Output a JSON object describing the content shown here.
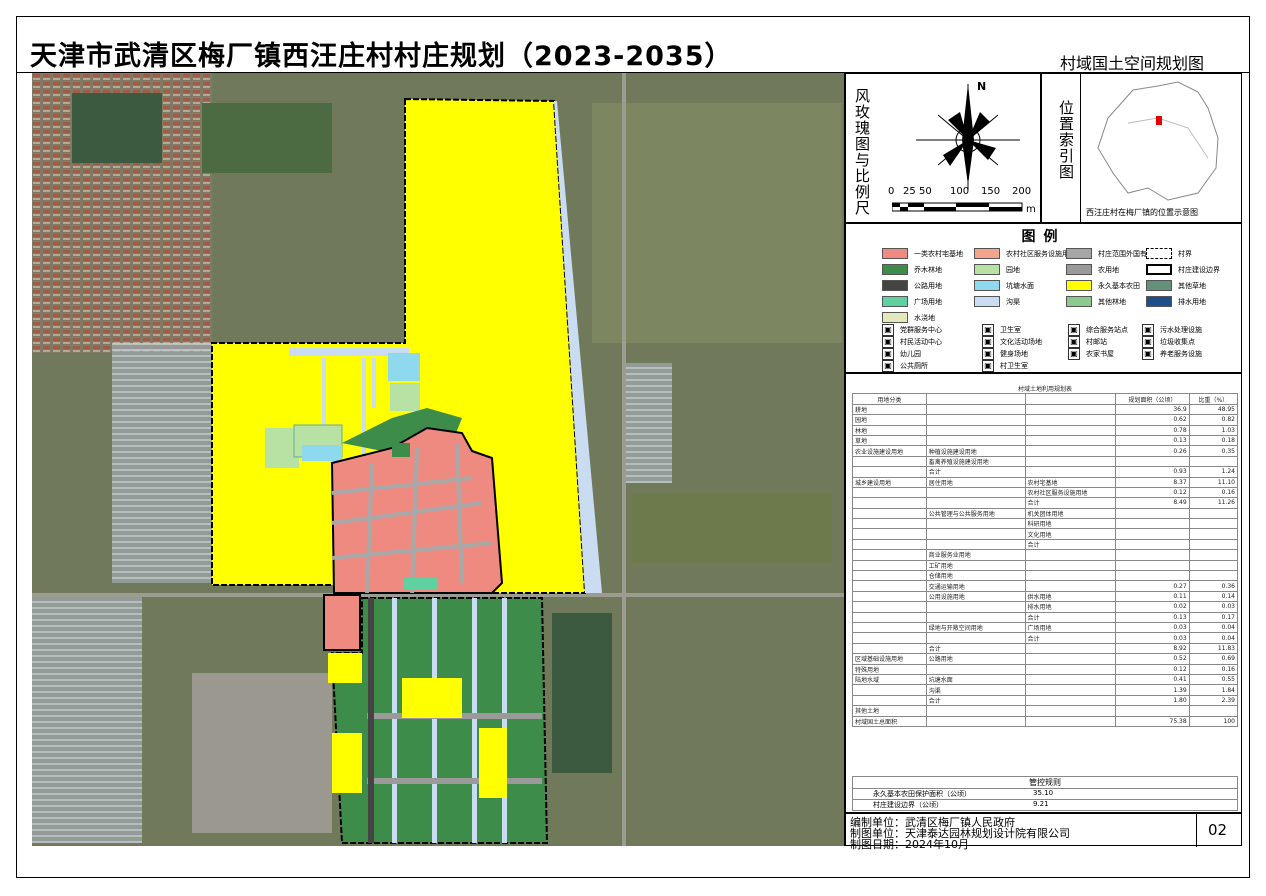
{
  "title": "天津市武清区梅厂镇西汪庄村村庄规划（2023-2035）",
  "subtitle": "村域国土空间规划图",
  "compass": {
    "north_label": "N",
    "vertical_label": "风玫瑰图与比例尺",
    "scale_ticks": [
      "0",
      "25",
      "50",
      "100",
      "150",
      "200"
    ],
    "scale_unit": "m"
  },
  "index_map": {
    "vertical_label": "位置索引图",
    "caption": "西汪庄村在梅厂镇的位置示意图",
    "highlight_color": "#e60000"
  },
  "legend": {
    "title": "图例",
    "swatches": [
      {
        "label": "一类农村宅基地",
        "color": "#ee8a80"
      },
      {
        "label": "农村社区服务设施用地",
        "color": "#f2a58c"
      },
      {
        "label": "村庄范围外国有用地",
        "color": "#a6a6a6"
      },
      {
        "label": "村界",
        "color": "#ffffff",
        "icon": "dashed-boundary"
      },
      {
        "label": "乔木林地",
        "color": "#3d8c4a"
      },
      {
        "label": "园地",
        "color": "#b7e2a3"
      },
      {
        "label": "农用地",
        "color": "#9a9a9a"
      },
      {
        "label": "村庄建设边界",
        "color": "#ffffff",
        "icon": "solid-boundary"
      },
      {
        "label": "公路用地",
        "color": "#444444"
      },
      {
        "label": "坑塘水面",
        "color": "#8fd9ee"
      },
      {
        "label": "永久基本农田",
        "color": "#ffff00"
      },
      {
        "label": "其他草地",
        "color": "#66907a"
      },
      {
        "label": "广场用地",
        "color": "#5fd1a0"
      },
      {
        "label": "沟渠",
        "color": "#c9dcf2"
      },
      {
        "label": "其他林地",
        "color": "#8cc98c"
      },
      {
        "label": "排水用地",
        "color": "#1f4e8c"
      },
      {
        "label": "水浇地",
        "color": "#e3e9b8"
      }
    ],
    "symbols": [
      {
        "label": "党群服务中心",
        "icon": "party-center-icon"
      },
      {
        "label": "卫生室",
        "icon": "clinic-icon"
      },
      {
        "label": "综合服务站点",
        "icon": "service-station-icon"
      },
      {
        "label": "污水处理设施",
        "icon": "sewage-icon"
      },
      {
        "label": "村民活动中心",
        "icon": "activity-center-icon"
      },
      {
        "label": "文化活动场地",
        "icon": "culture-icon"
      },
      {
        "label": "村邮站",
        "icon": "post-icon"
      },
      {
        "label": "垃圾收集点",
        "icon": "garbage-icon"
      },
      {
        "label": "幼儿园",
        "icon": "kindergarten-icon"
      },
      {
        "label": "健身场地",
        "icon": "fitness-icon"
      },
      {
        "label": "农家书屋",
        "icon": "library-icon"
      },
      {
        "label": "养老服务设施",
        "icon": "elderly-icon"
      },
      {
        "label": "公共厕所",
        "icon": "toilet-icon"
      },
      {
        "label": "村卫生室",
        "icon": "hospital-icon"
      }
    ]
  },
  "land_table": {
    "title": "村域土地利用规划表",
    "columns": [
      "用地分类",
      "",
      "",
      "规划面积（公顷）",
      "比重（%）"
    ],
    "rows": [
      [
        "耕地",
        "",
        "",
        "36.9",
        "48.95"
      ],
      [
        "园地",
        "",
        "",
        "0.62",
        "0.82"
      ],
      [
        "林地",
        "",
        "",
        "0.78",
        "1.03"
      ],
      [
        "草地",
        "",
        "",
        "0.13",
        "0.18"
      ],
      [
        "农业设施建设用地",
        "种植设施建设用地",
        "",
        "0.26",
        "0.35"
      ],
      [
        "",
        "畜禽养殖设施建设用地",
        "",
        "",
        ""
      ],
      [
        "",
        "合计",
        "",
        "0.93",
        "1.24"
      ],
      [
        "城乡建设用地",
        "居住用地",
        "农村宅基地",
        "8.37",
        "11.10"
      ],
      [
        "",
        "",
        "农村社区服务设施用地",
        "0.12",
        "0.16"
      ],
      [
        "",
        "",
        "合计",
        "8.49",
        "11.26"
      ],
      [
        "",
        "公共管理与公共服务用地",
        "机关团体用地",
        "",
        ""
      ],
      [
        "",
        "",
        "科研用地",
        "",
        ""
      ],
      [
        "",
        "",
        "文化用地",
        "",
        ""
      ],
      [
        "",
        "",
        "合计",
        "",
        ""
      ],
      [
        "",
        "商业服务业用地",
        "",
        "",
        ""
      ],
      [
        "",
        "工矿用地",
        "",
        "",
        ""
      ],
      [
        "",
        "仓储用地",
        "",
        "",
        ""
      ],
      [
        "",
        "交通运输用地",
        "",
        "0.27",
        "0.36"
      ],
      [
        "",
        "公用设施用地",
        "供水用地",
        "0.11",
        "0.14"
      ],
      [
        "",
        "",
        "排水用地",
        "0.02",
        "0.03"
      ],
      [
        "",
        "",
        "合计",
        "0.13",
        "0.17"
      ],
      [
        "",
        "绿地与开敞空间用地",
        "广场用地",
        "0.03",
        "0.04"
      ],
      [
        "",
        "",
        "合计",
        "0.03",
        "0.04"
      ],
      [
        "",
        "合计",
        "",
        "8.92",
        "11.83"
      ],
      [
        "区域基础设施用地",
        "公路用地",
        "",
        "0.52",
        "0.69"
      ],
      [
        "特殊用地",
        "",
        "",
        "0.12",
        "0.16"
      ],
      [
        "陆地水域",
        "坑塘水面",
        "",
        "0.41",
        "0.55"
      ],
      [
        "",
        "沟渠",
        "",
        "1.39",
        "1.84"
      ],
      [
        "",
        "合计",
        "",
        "1.80",
        "2.39"
      ],
      [
        "其他土地",
        "",
        "",
        "",
        ""
      ],
      [
        "村域国土总面积",
        "",
        "",
        "75.38",
        "100"
      ]
    ],
    "control_title": "管控规则",
    "control_rows": [
      [
        "永久基本农田保护面积（公顷）",
        "35.10"
      ],
      [
        "村庄建设边界（公顷）",
        "9.21"
      ]
    ]
  },
  "footer": {
    "org_label": "编制单位：武清区梅厂镇人民政府",
    "maker_label": "制图单位：天津泰达园林规划设计院有限公司",
    "date_label": "制图日期：2024年10月",
    "page": "02"
  },
  "map_colors": {
    "farmland": "#ffff00",
    "residential": "#ee8a80",
    "forest": "#3d8c4a",
    "ditch": "#c9dcf2",
    "pond": "#8fd9ee",
    "garden": "#b7e2a3",
    "road": "#9a9a9a"
  }
}
